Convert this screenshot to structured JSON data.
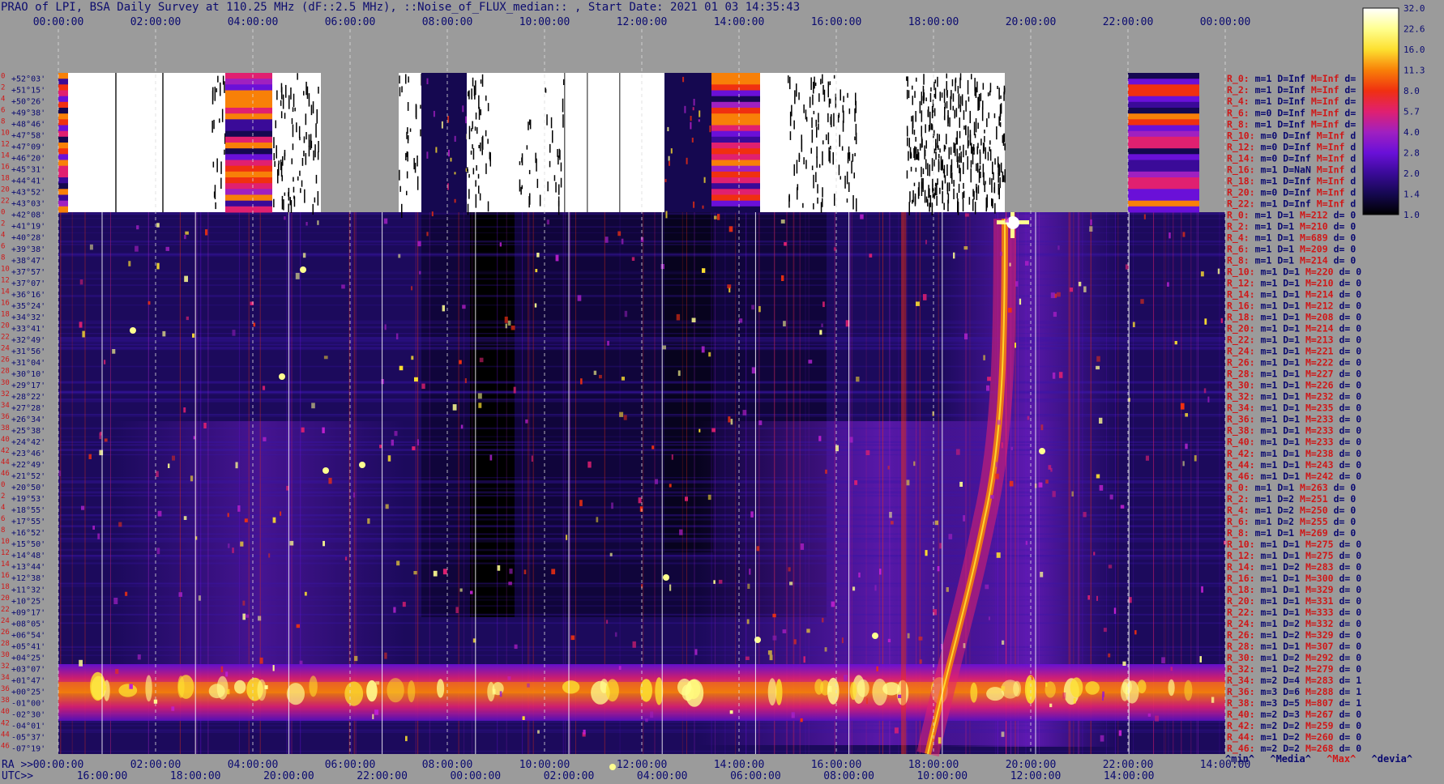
{
  "title": "PRAO of LPI, BSA Daily Survey at 110.25 MHz (dF::2.5 MHz), ::Noise_of_FLUX_median:: , Start Date: 2021 01 03 14:35:43",
  "chart_data": {
    "type": "heatmap",
    "title": "PRAO of LPI, BSA Daily Survey at 110.25 MHz (dF::2.5 MHz), ::Noise_of_FLUX_median:: , Start Date: 2021 01 03 14:35:43",
    "x_top_ticks": [
      "00:00:00",
      "02:00:00",
      "04:00:00",
      "06:00:00",
      "08:00:00",
      "10:00:00",
      "12:00:00",
      "14:00:00",
      "16:00:00",
      "18:00:00",
      "20:00:00",
      "22:00:00",
      "00:00:00"
    ],
    "x_ra_label": "RA >>",
    "x_ra_ticks": [
      "00:00:00",
      "02:00:00",
      "04:00:00",
      "06:00:00",
      "08:00:00",
      "10:00:00",
      "12:00:00",
      "14:00:00",
      "16:00:00",
      "18:00:00",
      "20:00:00",
      "22:00:00",
      "14:00:00"
    ],
    "x_utc_label": "UTC>>",
    "x_utc_ticks": [
      "16:00:00",
      "18:00:00",
      "20:00:00",
      "22:00:00",
      "00:00:00",
      "02:00:00",
      "04:00:00",
      "06:00:00",
      "08:00:00",
      "10:00:00",
      "12:00:00",
      "14:00:00"
    ],
    "dec_labels": [
      "+52°03'",
      "+51°15'",
      "+50°26'",
      "+49°38'",
      "+48°46'",
      "+47°58'",
      "+47°09'",
      "+46°20'",
      "+45°31'",
      "+44°41'",
      "+43°52'",
      "+43°03'",
      "+42°08'",
      "+41°19'",
      "+40°28'",
      "+39°38'",
      "+38°47'",
      "+37°57'",
      "+37°07'",
      "+36°16'",
      "+35°24'",
      "+34°32'",
      "+33°41'",
      "+32°49'",
      "+31°56'",
      "+31°04'",
      "+30°10'",
      "+29°17'",
      "+28°22'",
      "+27°28'",
      "+26°34'",
      "+25°38'",
      "+24°42'",
      "+23°46'",
      "+22°49'",
      "+21°52'",
      "+20°50'",
      "+19°53'",
      "+18°55'",
      "+17°55'",
      "+16°52'",
      "+15°50'",
      "+14°48'",
      "+13°44'",
      "+12°38'",
      "+11°32'",
      "+10°25'",
      "+09°17'",
      "+08°05'",
      "+06°54'",
      "+05°41'",
      "+04°25'",
      "+03°07'",
      "+01°47'",
      "+00°25'",
      "-01°00'",
      "-02°30'",
      "-04°01'",
      "-05°37'",
      "-07°19'"
    ],
    "dec_group_indices": [
      [
        "0",
        "2",
        "4",
        "6",
        "8",
        "10",
        "12",
        "14",
        "16",
        "18",
        "20",
        "22"
      ],
      [
        "0",
        "2",
        "4",
        "6",
        "8",
        "10",
        "12",
        "14",
        "16",
        "18",
        "20",
        "22",
        "24",
        "26",
        "28",
        "30",
        "32",
        "34",
        "36",
        "38",
        "40",
        "42",
        "44",
        "46"
      ],
      [
        "0",
        "2",
        "4",
        "6",
        "8",
        "10",
        "12",
        "14",
        "16",
        "18",
        "20",
        "22",
        "24",
        "26",
        "28",
        "30",
        "32",
        "34",
        "36",
        "38",
        "40",
        "42",
        "44",
        "46"
      ]
    ],
    "colorbar": {
      "ticks": [
        "32.0",
        "22.6",
        "16.0",
        "11.3",
        "8.0",
        "5.7",
        "4.0",
        "2.8",
        "2.0",
        "1.4",
        "1.0"
      ],
      "scale": "log",
      "range": [
        1.0,
        32.0
      ]
    },
    "colormap": [
      "#000000",
      "#150850",
      "#3a0a98",
      "#6a10d8",
      "#a020c0",
      "#e02070",
      "#f03010",
      "#f88008",
      "#fde030",
      "#ffff90",
      "#ffffff"
    ],
    "row_stats": [
      {
        "r": "R_0:",
        "m": "m=1",
        "d": "D=Inf",
        "mx": "M=Inf",
        "dv": "d="
      },
      {
        "r": "R_2:",
        "m": "m=1",
        "d": "D=Inf",
        "mx": "M=Inf",
        "dv": "d="
      },
      {
        "r": "R_4:",
        "m": "m=1",
        "d": "D=Inf",
        "mx": "M=Inf",
        "dv": "d="
      },
      {
        "r": "R_6:",
        "m": "m=0",
        "d": "D=Inf",
        "mx": "M=Inf",
        "dv": "d="
      },
      {
        "r": "R_8:",
        "m": "m=1",
        "d": "D=Inf",
        "mx": "M=Inf",
        "dv": "d="
      },
      {
        "r": "R_10:",
        "m": "m=0",
        "d": "D=Inf",
        "mx": "M=Inf",
        "dv": "d"
      },
      {
        "r": "R_12:",
        "m": "m=0",
        "d": "D=Inf",
        "mx": "M=Inf",
        "dv": "d"
      },
      {
        "r": "R_14:",
        "m": "m=0",
        "d": "D=Inf",
        "mx": "M=Inf",
        "dv": "d"
      },
      {
        "r": "R_16:",
        "m": "m=1",
        "d": "D=NaN",
        "mx": "M=Inf",
        "dv": "d"
      },
      {
        "r": "R_18:",
        "m": "m=1",
        "d": "D=Inf",
        "mx": "M=Inf",
        "dv": "d"
      },
      {
        "r": "R_20:",
        "m": "m=0",
        "d": "D=Inf",
        "mx": "M=Inf",
        "dv": "d"
      },
      {
        "r": "R_22:",
        "m": "m=1",
        "d": "D=Inf",
        "mx": "M=Inf",
        "dv": "d"
      },
      {
        "r": "R_0:",
        "m": "m=1",
        "d": "D=1",
        "mx": "M=212",
        "dv": "d= 0"
      },
      {
        "r": "R_2:",
        "m": "m=1",
        "d": "D=1",
        "mx": "M=210",
        "dv": "d= 0"
      },
      {
        "r": "R_4:",
        "m": "m=1",
        "d": "D=1",
        "mx": "M=689",
        "dv": "d= 0"
      },
      {
        "r": "R_6:",
        "m": "m=1",
        "d": "D=1",
        "mx": "M=209",
        "dv": "d= 0"
      },
      {
        "r": "R_8:",
        "m": "m=1",
        "d": "D=1",
        "mx": "M=214",
        "dv": "d= 0"
      },
      {
        "r": "R_10:",
        "m": "m=1",
        "d": "D=1",
        "mx": "M=220",
        "dv": "d= 0"
      },
      {
        "r": "R_12:",
        "m": "m=1",
        "d": "D=1",
        "mx": "M=210",
        "dv": "d= 0"
      },
      {
        "r": "R_14:",
        "m": "m=1",
        "d": "D=1",
        "mx": "M=214",
        "dv": "d= 0"
      },
      {
        "r": "R_16:",
        "m": "m=1",
        "d": "D=1",
        "mx": "M=212",
        "dv": "d= 0"
      },
      {
        "r": "R_18:",
        "m": "m=1",
        "d": "D=1",
        "mx": "M=208",
        "dv": "d= 0"
      },
      {
        "r": "R_20:",
        "m": "m=1",
        "d": "D=1",
        "mx": "M=214",
        "dv": "d= 0"
      },
      {
        "r": "R_22:",
        "m": "m=1",
        "d": "D=1",
        "mx": "M=213",
        "dv": "d= 0"
      },
      {
        "r": "R_24:",
        "m": "m=1",
        "d": "D=1",
        "mx": "M=221",
        "dv": "d= 0"
      },
      {
        "r": "R_26:",
        "m": "m=1",
        "d": "D=1",
        "mx": "M=222",
        "dv": "d= 0"
      },
      {
        "r": "R_28:",
        "m": "m=1",
        "d": "D=1",
        "mx": "M=227",
        "dv": "d= 0"
      },
      {
        "r": "R_30:",
        "m": "m=1",
        "d": "D=1",
        "mx": "M=226",
        "dv": "d= 0"
      },
      {
        "r": "R_32:",
        "m": "m=1",
        "d": "D=1",
        "mx": "M=232",
        "dv": "d= 0"
      },
      {
        "r": "R_34:",
        "m": "m=1",
        "d": "D=1",
        "mx": "M=235",
        "dv": "d= 0"
      },
      {
        "r": "R_36:",
        "m": "m=1",
        "d": "D=1",
        "mx": "M=233",
        "dv": "d= 0"
      },
      {
        "r": "R_38:",
        "m": "m=1",
        "d": "D=1",
        "mx": "M=233",
        "dv": "d= 0"
      },
      {
        "r": "R_40:",
        "m": "m=1",
        "d": "D=1",
        "mx": "M=233",
        "dv": "d= 0"
      },
      {
        "r": "R_42:",
        "m": "m=1",
        "d": "D=1",
        "mx": "M=238",
        "dv": "d= 0"
      },
      {
        "r": "R_44:",
        "m": "m=1",
        "d": "D=1",
        "mx": "M=243",
        "dv": "d= 0"
      },
      {
        "r": "R_46:",
        "m": "m=1",
        "d": "D=1",
        "mx": "M=242",
        "dv": "d= 0"
      },
      {
        "r": "R_0:",
        "m": "m=1",
        "d": "D=1",
        "mx": "M=263",
        "dv": "d= 0"
      },
      {
        "r": "R_2:",
        "m": "m=1",
        "d": "D=2",
        "mx": "M=251",
        "dv": "d= 0"
      },
      {
        "r": "R_4:",
        "m": "m=1",
        "d": "D=2",
        "mx": "M=250",
        "dv": "d= 0"
      },
      {
        "r": "R_6:",
        "m": "m=1",
        "d": "D=2",
        "mx": "M=255",
        "dv": "d= 0"
      },
      {
        "r": "R_8:",
        "m": "m=1",
        "d": "D=1",
        "mx": "M=269",
        "dv": "d= 0"
      },
      {
        "r": "R_10:",
        "m": "m=1",
        "d": "D=1",
        "mx": "M=275",
        "dv": "d= 0"
      },
      {
        "r": "R_12:",
        "m": "m=1",
        "d": "D=1",
        "mx": "M=275",
        "dv": "d= 0"
      },
      {
        "r": "R_14:",
        "m": "m=1",
        "d": "D=2",
        "mx": "M=283",
        "dv": "d= 0"
      },
      {
        "r": "R_16:",
        "m": "m=1",
        "d": "D=1",
        "mx": "M=300",
        "dv": "d= 0"
      },
      {
        "r": "R_18:",
        "m": "m=1",
        "d": "D=1",
        "mx": "M=329",
        "dv": "d= 0"
      },
      {
        "r": "R_20:",
        "m": "m=1",
        "d": "D=1",
        "mx": "M=331",
        "dv": "d= 0"
      },
      {
        "r": "R_22:",
        "m": "m=1",
        "d": "D=1",
        "mx": "M=333",
        "dv": "d= 0"
      },
      {
        "r": "R_24:",
        "m": "m=1",
        "d": "D=2",
        "mx": "M=332",
        "dv": "d= 0"
      },
      {
        "r": "R_26:",
        "m": "m=1",
        "d": "D=2",
        "mx": "M=329",
        "dv": "d= 0"
      },
      {
        "r": "R_28:",
        "m": "m=1",
        "d": "D=1",
        "mx": "M=307",
        "dv": "d= 0"
      },
      {
        "r": "R_30:",
        "m": "m=1",
        "d": "D=2",
        "mx": "M=292",
        "dv": "d= 0"
      },
      {
        "r": "R_32:",
        "m": "m=1",
        "d": "D=2",
        "mx": "M=279",
        "dv": "d= 0"
      },
      {
        "r": "R_34:",
        "m": "m=2",
        "d": "D=4",
        "mx": "M=283",
        "dv": "d= 1"
      },
      {
        "r": "R_36:",
        "m": "m=3",
        "d": "D=6",
        "mx": "M=288",
        "dv": "d= 1"
      },
      {
        "r": "R_38:",
        "m": "m=3",
        "d": "D=5",
        "mx": "M=807",
        "dv": "d= 1"
      },
      {
        "r": "R_40:",
        "m": "m=2",
        "d": "D=3",
        "mx": "M=267",
        "dv": "d= 0"
      },
      {
        "r": "R_42:",
        "m": "m=2",
        "d": "D=2",
        "mx": "M=259",
        "dv": "d= 0"
      },
      {
        "r": "R_44:",
        "m": "m=1",
        "d": "D=2",
        "mx": "M=260",
        "dv": "d= 0"
      },
      {
        "r": "R_46:",
        "m": "m=2",
        "d": "D=2",
        "mx": "M=268",
        "dv": "d= 0"
      }
    ]
  },
  "footer": {
    "min": "^min^",
    "median": "^Media^",
    "max": "^Max^",
    "devia": "^devia^"
  }
}
